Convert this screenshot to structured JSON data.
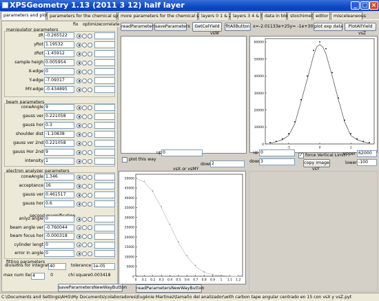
{
  "window": {
    "title": "XPSGeometry 1.13   (2011 3 12) half layer"
  },
  "tabs": [
    "parameters and plots",
    "parameters for the chemical species",
    "more parameters for the chemical species",
    "layers 0 1 & 2",
    "layers 3 4 & 5",
    "data in block",
    "stoichimetry",
    "editor",
    "misceleaneous"
  ],
  "columns": {
    "fix": "fix",
    "optimize": "optimize",
    "correlate": "correlate"
  },
  "manipulator": {
    "title": "manipulator parameters",
    "params": [
      {
        "label": "zR",
        "value": "-0.265522",
        "sel": 0
      },
      {
        "label": "yRot",
        "value": "1.19532",
        "sel": 0
      },
      {
        "label": "zRot",
        "value": "-1.45912",
        "sel": 0
      },
      {
        "label": "sample heigh",
        "value": "0.005954",
        "sel": 0
      },
      {
        "label": "X-edge",
        "value": "0",
        "sel": 0
      },
      {
        "label": "Y-edge",
        "value": "-7.09317",
        "sel": 0
      },
      {
        "label": "MY-edge",
        "value": "-0.434895",
        "sel": 0
      }
    ]
  },
  "beam": {
    "title": "beam parameters",
    "params": [
      {
        "label": "coneAngle",
        "value": "9",
        "sel": 0
      },
      {
        "label": "gauss ver",
        "value": "0.221058",
        "sel": 0
      },
      {
        "label": "gauss hor",
        "value": "0.3",
        "sel": 0
      },
      {
        "label": "shoulder dist",
        "value": "-1.10838",
        "sel": 0
      },
      {
        "label": "gauss ver 2nd",
        "value": "0.221058",
        "sel": 0
      },
      {
        "label": "gauss Hor 2nd",
        "value": "9",
        "sel": 0
      },
      {
        "label": "intensity",
        "value": "1",
        "sel": 0
      }
    ]
  },
  "analyzer": {
    "title": "electron analyzer parameters",
    "params": [
      {
        "label": "coneAngle",
        "value": "1.346",
        "sel": 0
      },
      {
        "label": "acceptance",
        "value": "16",
        "sel": 0
      },
      {
        "label": "gauss ver",
        "value": "0.461517",
        "sel": 0
      },
      {
        "label": "gauss hor",
        "value": "0.6",
        "sel": 0
      }
    ],
    "second_title": "second magnification",
    "params2": [
      {
        "label": "anlyz angle",
        "value": "0",
        "sel": 0
      },
      {
        "label": "beam angle ver",
        "value": "-0.760044",
        "sel": 0
      },
      {
        "label": "beam focus hor",
        "value": "-0.000318",
        "sel": 0
      },
      {
        "label": "cylinder lengt",
        "value": "0",
        "sel": 0
      },
      {
        "label": "error in angle",
        "value": "0",
        "sel": 0
      }
    ]
  },
  "fitting": {
    "title": "fitting parameters",
    "divisions_label": "divisions for integration",
    "divisions_value": "40",
    "tolerance_label": "tolerance",
    "tolerance_value": "1e-05",
    "max_label": "max num iters",
    "max_value": "4",
    "iter_value": "0",
    "chi_label": "chi square",
    "chi_value": "0.003418"
  },
  "buttons": {
    "read_params": "readParameters",
    "save_params": "saveParameters",
    "get_cel_yield": "GetCelYield",
    "fit_all": "fitAllButton",
    "plot_exp": "plot exp data",
    "plot_all": "PlotAllYield",
    "save_new_way": "saveParametersNewWayButton",
    "read_new_way": "readParametersNewWayButton",
    "copy_image": "copy image"
  },
  "formula": "x=-2.01133e+25y=   -1e+30",
  "plots": {
    "vsW_title": "vsW",
    "vsZ_title": "vsZ",
    "vsX_title": "vsX or vsMY",
    "vsY_title": "vsY"
  },
  "controls": {
    "up_label": "up",
    "up_value": "0",
    "down_label": "down",
    "down_value": "2",
    "plot_this_way": "plot this way",
    "up2_value": "0",
    "down2_value": "3",
    "force_vertical": "force Vertical Limit",
    "upper_label": "upper",
    "upper_value": "62000",
    "lower_label": "lower",
    "lower_value": "-100"
  },
  "status": "C:\\Documents and Settings\\AHG\\My Documents\\colaboradores\\Eugènie Martinez\\tamaño del analizador\\with carbon tape angular centrado en 15 con vsX y vsZ.pyt",
  "chart_data": [
    {
      "type": "line",
      "title": "vsZ",
      "xlabel": "",
      "ylabel": "",
      "x_ticks": [
        -1,
        0,
        1
      ],
      "y_ticks": [
        0,
        10000,
        20000,
        30000,
        40000,
        50000,
        60000
      ],
      "xlim": [
        -1.75,
        1.75
      ],
      "ylim": [
        0,
        62000
      ],
      "series": [
        {
          "x": [
            -1.6,
            -1.4,
            -1.2,
            -1.0,
            -0.8,
            -0.6,
            -0.4,
            -0.2,
            -0.1,
            0.0,
            0.1,
            0.2,
            0.4,
            0.6,
            0.8,
            1.0,
            1.2,
            1.4,
            1.6
          ],
          "y": [
            500,
            1200,
            2500,
            5000,
            12000,
            25000,
            38000,
            52000,
            57000,
            58500,
            57000,
            53000,
            40000,
            26000,
            13000,
            5000,
            2500,
            1200,
            500
          ]
        }
      ],
      "points": {
        "x": [
          -1.6,
          -1.4,
          -1.2,
          -1.0,
          -0.8,
          -0.6,
          -0.4,
          -0.2,
          0.0,
          0.2,
          0.4,
          0.6,
          0.8,
          1.0,
          1.2,
          1.4,
          1.6
        ],
        "y": [
          800,
          1500,
          3000,
          6000,
          13000,
          26000,
          40000,
          55000,
          60000,
          56000,
          42000,
          27000,
          14000,
          6000,
          3000,
          1500,
          800
        ]
      }
    },
    {
      "type": "line",
      "title": "vsX or vsMY",
      "xlabel": "",
      "ylabel": "",
      "x_ticks": [
        0,
        0.1,
        0.2,
        0.3,
        0.4,
        0.5,
        0.6,
        0.7,
        0.8,
        0.9,
        1,
        1.1,
        1.2
      ],
      "y_ticks": [
        0,
        5000,
        10000,
        15000,
        20000,
        25000,
        30000,
        35000,
        40000,
        45000,
        50000
      ],
      "xlim": [
        0,
        1.25
      ],
      "ylim": [
        0,
        52000
      ],
      "series": [
        {
          "x": [
            0,
            0.1,
            0.2,
            0.3,
            0.4,
            0.5,
            0.6,
            0.7,
            0.8,
            0.9,
            1.0,
            1.1,
            1.2
          ],
          "y": [
            50000,
            48000,
            43000,
            35000,
            26000,
            17000,
            10000,
            5000,
            2000,
            800,
            300,
            100,
            50
          ]
        }
      ],
      "points": {
        "x": [
          0,
          0.1,
          0.2,
          0.3,
          0.4,
          0.5,
          0.6,
          0.7,
          0.8,
          0.9,
          1.0,
          1.1,
          1.2
        ],
        "y": [
          51000,
          48500,
          43500,
          35500,
          26500,
          17500,
          10500,
          5500,
          2200,
          900,
          350,
          120,
          60
        ]
      }
    }
  ]
}
